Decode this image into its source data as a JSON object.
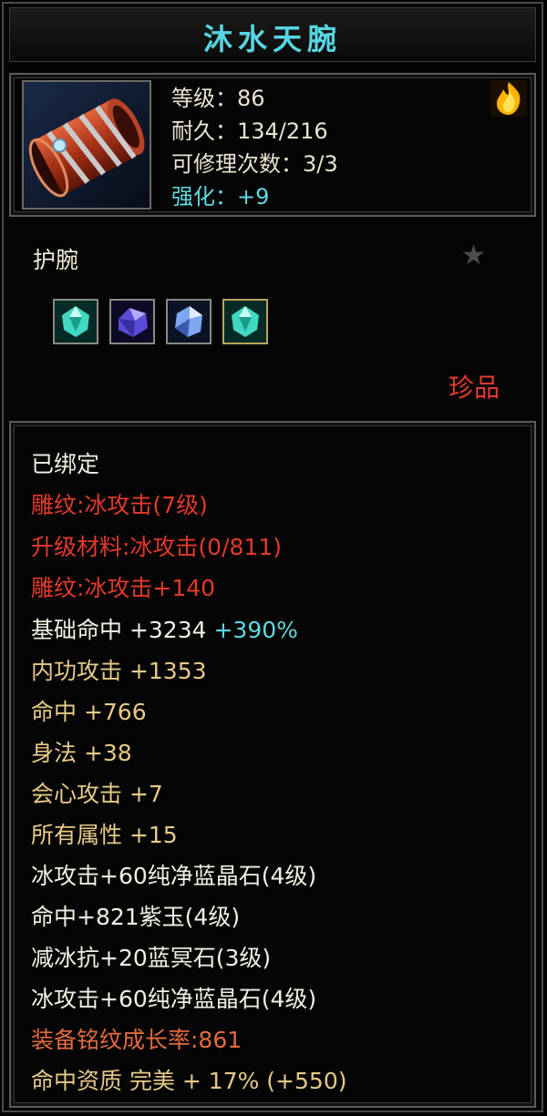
{
  "item": {
    "name": "沐水天腕",
    "level": "等级：86",
    "durability": "耐久：134/216",
    "repair": "可修理次数：3/3",
    "enhance": "强化：+9",
    "type": "护腕",
    "rarity": "珍品",
    "icon": "bracer-icon",
    "badge_icon": "fire-badge-icon",
    "favorite_icon": "star-icon"
  },
  "gems": [
    {
      "icon": "cyan-gem-icon",
      "color": "#3fd8c0"
    },
    {
      "icon": "purple-gem-icon",
      "color": "#7a6cf0"
    },
    {
      "icon": "blue-gem-icon",
      "color": "#8fb8ff"
    },
    {
      "icon": "cyan-gem-icon",
      "color": "#3fd8c0"
    }
  ],
  "attributes": {
    "bound": "已绑定",
    "engrave_level": "雕纹:冰攻击(7级)",
    "upgrade_material": "升级材料:冰攻击(0/811)",
    "engrave_bonus": "雕纹:冰攻击+140",
    "base_hit_label": "基础命中  +3234 ",
    "base_hit_pct": "+390%",
    "internal_attack": "内功攻击  +1353",
    "hit": "命中  +766",
    "agility": "身法  +38",
    "crit_attack": "会心攻击  +7",
    "all_attributes": "所有属性  +15",
    "gem_line_1": "冰攻击+60纯净蓝晶石(4级)",
    "gem_line_2": "命中+821紫玉(4级)",
    "gem_line_3": "减冰抗+20蓝冥石(3级)",
    "gem_line_4": "冰攻击+60纯净蓝晶石(4级)",
    "growth_rate": "装备铭纹成长率:861",
    "hit_quality": "命中资质  完美  + 17% (+550)"
  },
  "colors": {
    "title": "#56d6e2",
    "red": "#e2392b",
    "gold": "#e7c987",
    "cyan": "#5fd8e0",
    "orange": "#e16a3c"
  }
}
